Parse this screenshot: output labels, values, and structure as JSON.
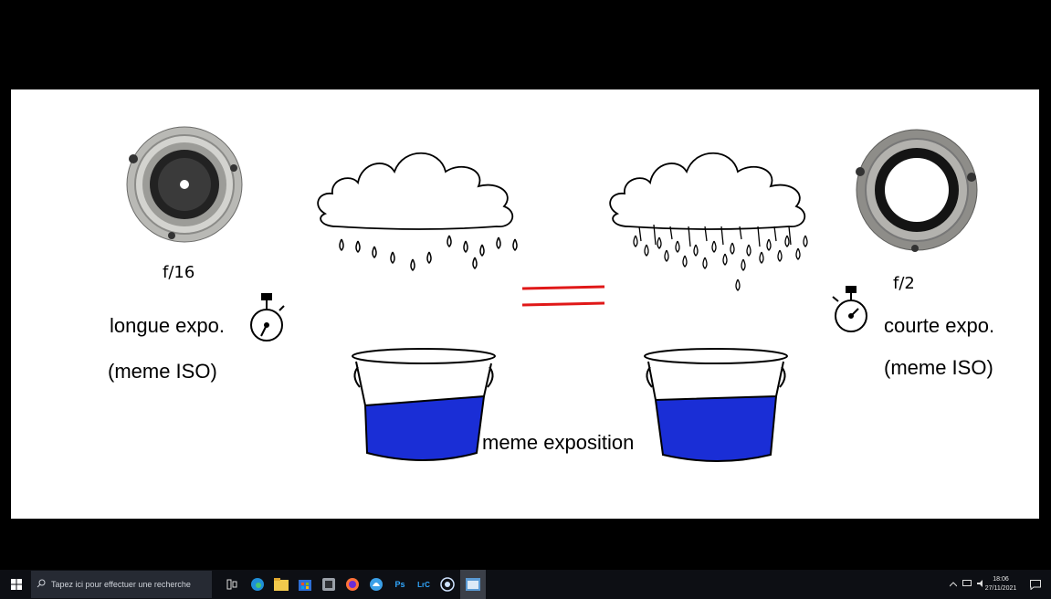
{
  "slide": {
    "left_aperture": "f/16",
    "left_exposure": "longue expo.",
    "left_iso": "(meme ISO)",
    "right_aperture": "f/2",
    "right_exposure": "courte expo.",
    "right_iso": "(meme ISO)",
    "center_caption": "meme exposition",
    "colors": {
      "water": "#1a2ed6",
      "equals": "#e01818",
      "lens_metal": "#a9a9a6"
    }
  },
  "taskbar": {
    "start_icon": "windows-logo-icon",
    "search_placeholder": "Tapez ici pour effectuer une recherche",
    "apps": [
      "task-view-icon",
      "edge-icon",
      "file-explorer-icon",
      "store-icon",
      "app-icon",
      "firefox-icon",
      "app2-icon",
      "photoshop-icon",
      "lightroom-classic-icon",
      "browser-icon",
      "active-window-icon"
    ],
    "ps_label": "Ps",
    "lrc_label": "LrC",
    "clock_time": "18:06",
    "clock_date": "27/11/2021"
  }
}
